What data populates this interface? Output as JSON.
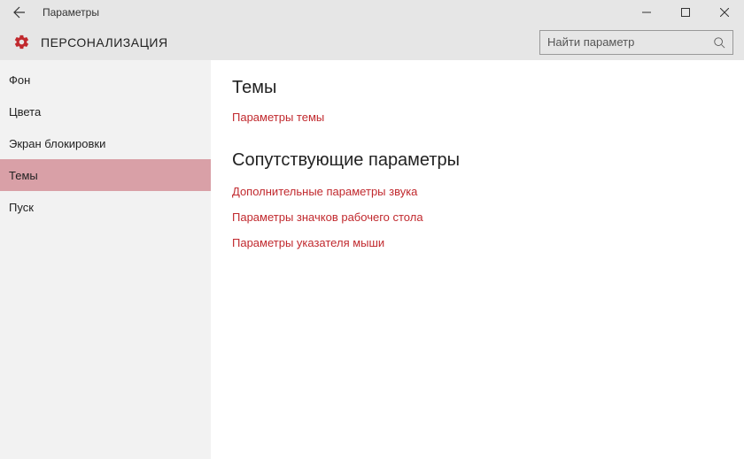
{
  "titlebar": {
    "title": "Параметры"
  },
  "header": {
    "title": "ПЕРСОНАЛИЗАЦИЯ"
  },
  "search": {
    "placeholder": "Найти параметр"
  },
  "sidebar": {
    "items": [
      {
        "label": "Фон"
      },
      {
        "label": "Цвета"
      },
      {
        "label": "Экран блокировки"
      },
      {
        "label": "Темы"
      },
      {
        "label": "Пуск"
      }
    ],
    "active_index": 3
  },
  "content": {
    "section1": {
      "heading": "Темы"
    },
    "link1": "Параметры темы",
    "section2": {
      "heading": "Сопутствующие параметры"
    },
    "link2": "Дополнительные параметры звука",
    "link3": "Параметры значков рабочего стола",
    "link4": "Параметры указателя мыши"
  }
}
